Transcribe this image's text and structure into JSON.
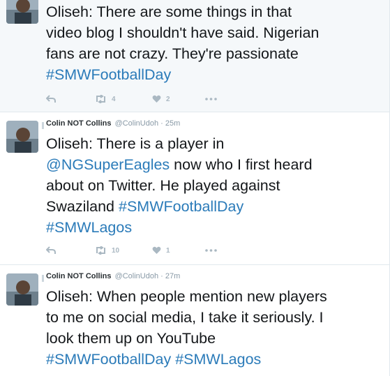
{
  "tweets": [
    {
      "lines": [
        [
          {
            "text": "Oliseh: There are some things in that",
            "kind": "plain"
          }
        ],
        [
          {
            "text": "video blog I shouldn't have said. Nigerian",
            "kind": "plain"
          }
        ],
        [
          {
            "text": "fans are not crazy. They're passionate",
            "kind": "plain"
          }
        ],
        [
          {
            "text": "#SMWFootballDay",
            "kind": "tag"
          }
        ]
      ],
      "retweets": "4",
      "likes": "2"
    },
    {
      "name": "Colin NOT Collins",
      "handle": "@ColinUdoh",
      "separator": "·",
      "time": "25m",
      "lines": [
        [
          {
            "text": "Oliseh: There is a player in",
            "kind": "plain"
          }
        ],
        [
          {
            "text": "@NGSuperEagles",
            "kind": "mention"
          },
          {
            "text": " now who I first heard",
            "kind": "plain"
          }
        ],
        [
          {
            "text": "about on Twitter. He played against",
            "kind": "plain"
          }
        ],
        [
          {
            "text": "Swaziland ",
            "kind": "plain"
          },
          {
            "text": "#SMWFootballDay",
            "kind": "tag"
          }
        ],
        [
          {
            "text": "#SMWLagos",
            "kind": "tag"
          }
        ]
      ],
      "retweets": "10",
      "likes": "1"
    },
    {
      "name": "Colin NOT Collins",
      "handle": "@ColinUdoh",
      "separator": "·",
      "time": "27m",
      "lines": [
        [
          {
            "text": "Oliseh: When people mention new players",
            "kind": "plain"
          }
        ],
        [
          {
            "text": "to me on social media, I take it seriously. I",
            "kind": "plain"
          }
        ],
        [
          {
            "text": "look them up on YouTube",
            "kind": "plain"
          }
        ],
        [
          {
            "text": "#SMWFootballDay",
            "kind": "tag"
          },
          {
            "text": " ",
            "kind": "plain"
          },
          {
            "text": "#SMWLagos",
            "kind": "tag"
          }
        ]
      ]
    }
  ],
  "icons": {
    "reply": "reply-icon",
    "retweet": "retweet-icon",
    "like": "heart-icon",
    "more": "more-icon"
  },
  "colors": {
    "link": "#2b7bb9",
    "text": "#14171a",
    "meta": "#8899a6",
    "action": "#aab8c2",
    "highlight_bg": "#f5f8fa"
  }
}
